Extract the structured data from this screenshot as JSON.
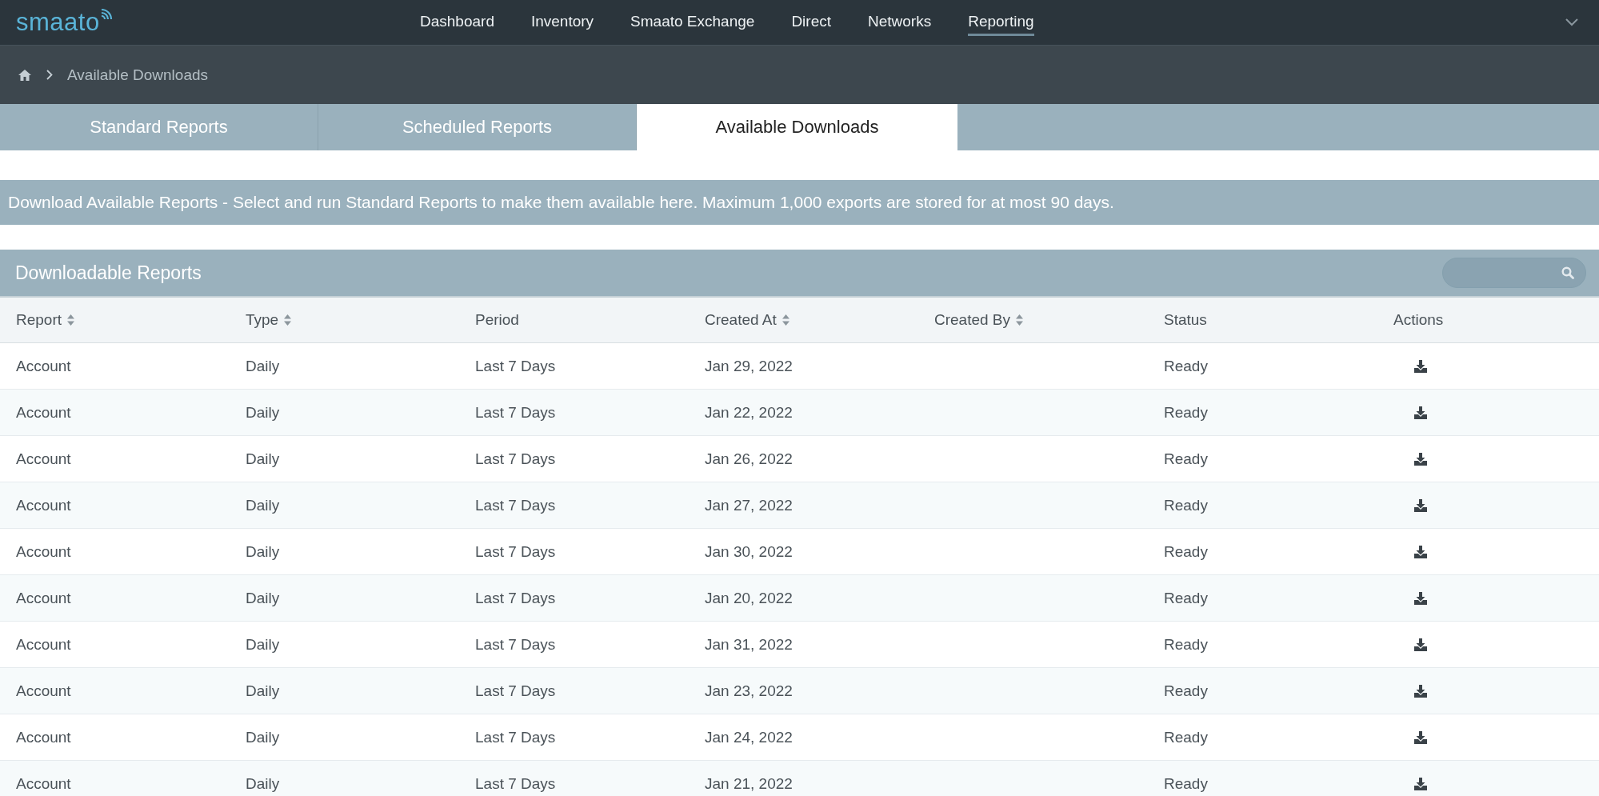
{
  "brand": "smaato",
  "nav": [
    {
      "label": "Dashboard",
      "selected": false
    },
    {
      "label": "Inventory",
      "selected": false
    },
    {
      "label": "Smaato Exchange",
      "selected": false
    },
    {
      "label": "Direct",
      "selected": false
    },
    {
      "label": "Networks",
      "selected": false
    },
    {
      "label": "Reporting",
      "selected": true
    }
  ],
  "breadcrumb": [
    "Available Downloads"
  ],
  "tabs": [
    {
      "label": "Standard Reports",
      "selected": false
    },
    {
      "label": "Scheduled Reports",
      "selected": false
    },
    {
      "label": "Available Downloads",
      "selected": true
    }
  ],
  "info": "Download Available Reports - Select and run Standard Reports to make them available here. Maximum 1,000 exports are stored for at most 90 days.",
  "panel": {
    "title": "Downloadable Reports"
  },
  "table": {
    "columns": [
      {
        "label": "Report",
        "sortable": true
      },
      {
        "label": "Type",
        "sortable": true
      },
      {
        "label": "Period",
        "sortable": false
      },
      {
        "label": "Created At",
        "sortable": true
      },
      {
        "label": "Created By",
        "sortable": true
      },
      {
        "label": "Status",
        "sortable": false
      },
      {
        "label": "Actions",
        "sortable": false
      }
    ],
    "rows": [
      [
        "Account",
        "Daily",
        "Last 7 Days",
        "Jan 29, 2022",
        "",
        "Ready"
      ],
      [
        "Account",
        "Daily",
        "Last 7 Days",
        "Jan 22, 2022",
        "",
        "Ready"
      ],
      [
        "Account",
        "Daily",
        "Last 7 Days",
        "Jan 26, 2022",
        "",
        "Ready"
      ],
      [
        "Account",
        "Daily",
        "Last 7 Days",
        "Jan 27, 2022",
        "",
        "Ready"
      ],
      [
        "Account",
        "Daily",
        "Last 7 Days",
        "Jan 30, 2022",
        "",
        "Ready"
      ],
      [
        "Account",
        "Daily",
        "Last 7 Days",
        "Jan 20, 2022",
        "",
        "Ready"
      ],
      [
        "Account",
        "Daily",
        "Last 7 Days",
        "Jan 31, 2022",
        "",
        "Ready"
      ],
      [
        "Account",
        "Daily",
        "Last 7 Days",
        "Jan 23, 2022",
        "",
        "Ready"
      ],
      [
        "Account",
        "Daily",
        "Last 7 Days",
        "Jan 24, 2022",
        "",
        "Ready"
      ],
      [
        "Account",
        "Daily",
        "Last 7 Days",
        "Jan 21, 2022",
        "",
        "Ready"
      ]
    ]
  }
}
